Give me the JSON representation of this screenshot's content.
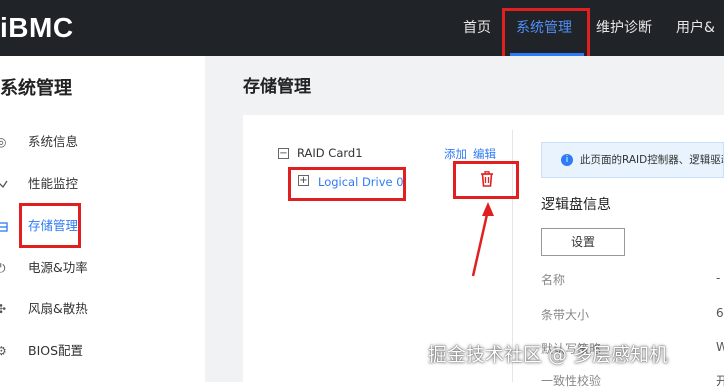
{
  "header": {
    "logo": "iBMC",
    "nav": [
      "首页",
      "系统管理",
      "维护诊断",
      "用户&安"
    ],
    "active_nav": "系统管理"
  },
  "sidebar": {
    "title": "系统管理",
    "items": [
      {
        "label": "系统信息",
        "icon": "info-icon"
      },
      {
        "label": "性能监控",
        "icon": "chart-icon"
      },
      {
        "label": "存储管理",
        "icon": "storage-icon",
        "active": true
      },
      {
        "label": "电源&功率",
        "icon": "power-icon"
      },
      {
        "label": "风扇&散热",
        "icon": "fan-icon"
      },
      {
        "label": "BIOS配置",
        "icon": "gear-icon"
      }
    ]
  },
  "main": {
    "title": "存储管理",
    "tree": {
      "controller": "RAID Card1",
      "drive": "Logical Drive 0",
      "add_label": "添加",
      "edit_label": "编辑"
    },
    "info_text": "此页面的RAID控制器、逻辑驱动",
    "section_title": "逻辑盘信息",
    "settings_button": "设置",
    "fields": [
      {
        "label": "名称",
        "value": "-"
      },
      {
        "label": "条带大小",
        "value": "6"
      },
      {
        "label": "默认写策略",
        "value": "W"
      },
      {
        "label": "一致性校验",
        "value": "开"
      }
    ]
  },
  "watermark": "掘金技术社区 @ 多层感知机",
  "colors": {
    "topbar": "#202327",
    "accent": "#2f7bf5",
    "highlight": "#e02020"
  }
}
